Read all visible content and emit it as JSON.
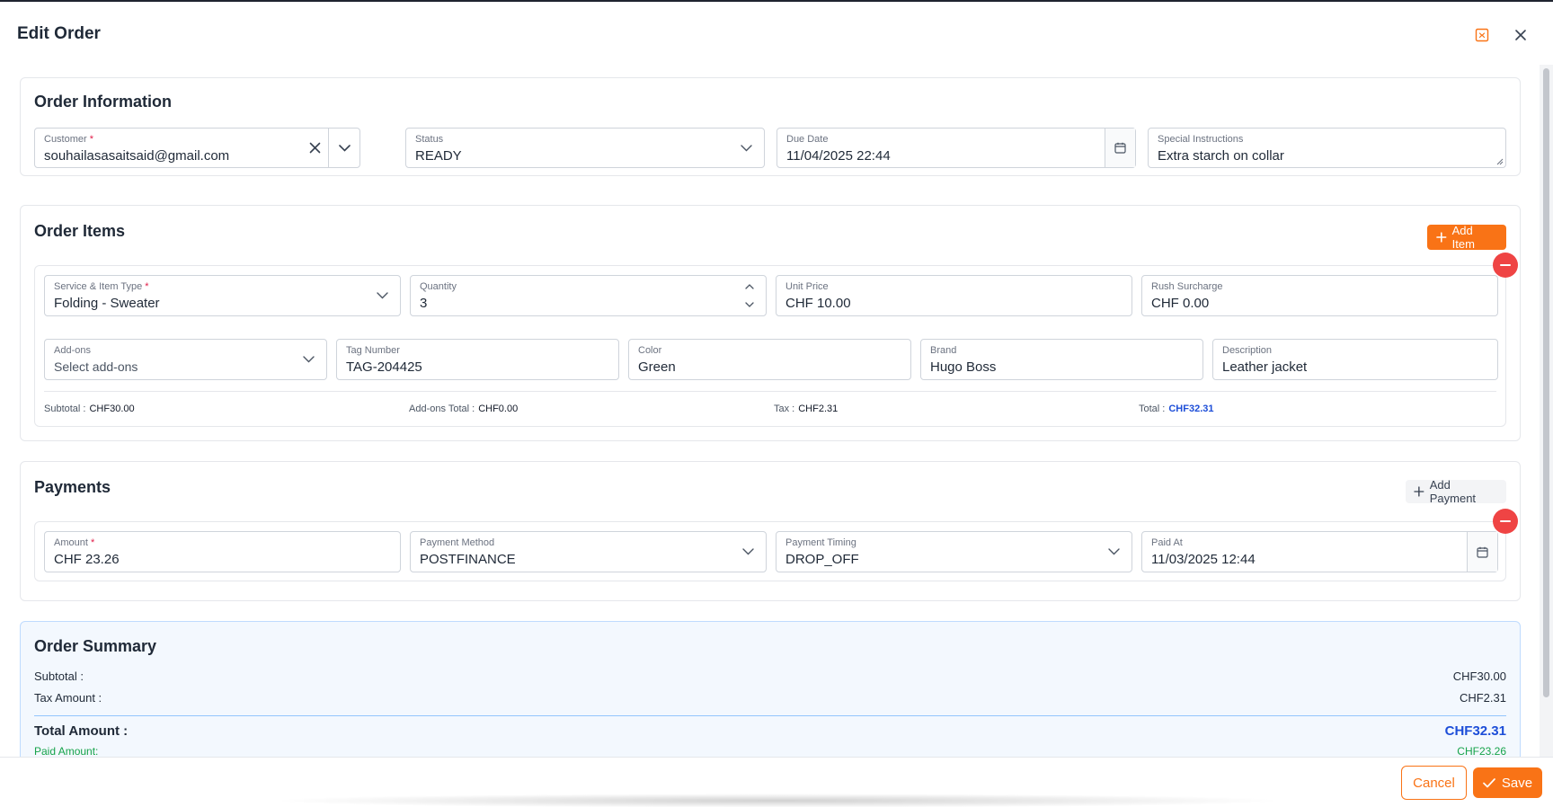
{
  "dialog": {
    "title": "Edit Order"
  },
  "order_information": {
    "title": "Order Information",
    "customer": {
      "label": "Customer",
      "value": "souhailasasaitsaid@gmail.com"
    },
    "status": {
      "label": "Status",
      "value": "READY"
    },
    "due_date": {
      "label": "Due Date",
      "value": "11/04/2025 22:44"
    },
    "special_instructions": {
      "label": "Special Instructions",
      "value": "Extra starch on collar"
    }
  },
  "order_items": {
    "title": "Order Items",
    "add_item_label": "Add Item",
    "items": [
      {
        "service_type": {
          "label": "Service & Item Type",
          "value": "Folding - Sweater"
        },
        "quantity": {
          "label": "Quantity",
          "value": "3"
        },
        "unit_price": {
          "label": "Unit Price",
          "value": "CHF 10.00"
        },
        "rush_surcharge": {
          "label": "Rush Surcharge",
          "value": "CHF 0.00"
        },
        "addons": {
          "label": "Add-ons",
          "placeholder": "Select add-ons"
        },
        "tag_number": {
          "label": "Tag Number",
          "value": "TAG-204425"
        },
        "color": {
          "label": "Color",
          "value": "Green"
        },
        "brand": {
          "label": "Brand",
          "value": "Hugo Boss"
        },
        "description": {
          "label": "Description",
          "value": "Leather jacket"
        },
        "totals": {
          "subtotal_label": "Subtotal :",
          "subtotal": "CHF30.00",
          "addons_label": "Add-ons Total :",
          "addons_total": "CHF0.00",
          "tax_label": "Tax :",
          "tax": "CHF2.31",
          "total_label": "Total :",
          "total": "CHF32.31"
        }
      }
    ]
  },
  "payments": {
    "title": "Payments",
    "add_payment_label": "Add Payment",
    "items": [
      {
        "amount": {
          "label": "Amount",
          "value": "CHF 23.26"
        },
        "method": {
          "label": "Payment Method",
          "value": "POSTFINANCE"
        },
        "timing": {
          "label": "Payment Timing",
          "value": "DROP_OFF"
        },
        "paid_at": {
          "label": "Paid At",
          "value": "11/03/2025 12:44"
        }
      }
    ]
  },
  "summary": {
    "title": "Order Summary",
    "subtotal_label": "Subtotal :",
    "subtotal": "CHF30.00",
    "tax_label": "Tax Amount :",
    "tax": "CHF2.31",
    "total_label": "Total Amount :",
    "total": "CHF32.31",
    "paid_label": "Paid Amount:",
    "paid": "CHF23.26"
  },
  "footer": {
    "cancel_label": "Cancel",
    "save_label": "Save"
  },
  "colors": {
    "accent": "#f97316",
    "danger": "#ef4444",
    "link_blue": "#1d4ed8",
    "paid_green": "#16a34a"
  },
  "icons": {
    "minimize": "minimize-window-icon",
    "close": "close-icon",
    "clear": "clear-x-icon",
    "chevron": "chevron-down-icon",
    "calendar": "calendar-icon",
    "plus": "plus-icon",
    "minus": "minus-icon",
    "check": "check-icon"
  }
}
